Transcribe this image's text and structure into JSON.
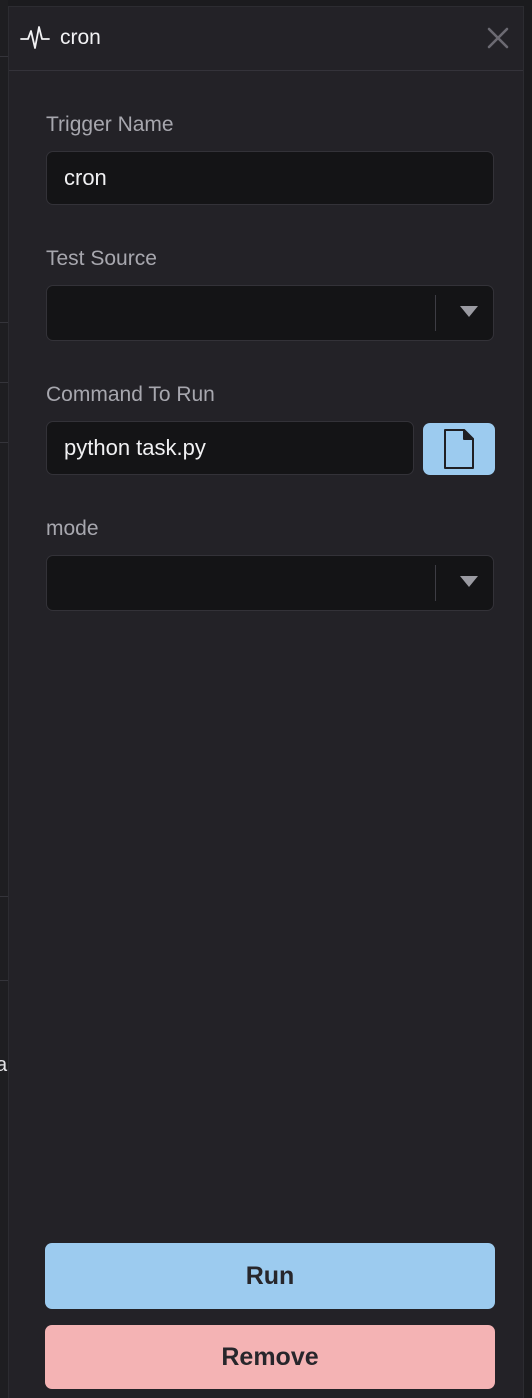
{
  "header": {
    "title": "cron",
    "icon": "activity-pulse-icon",
    "close_icon": "close-icon"
  },
  "form": {
    "trigger_name": {
      "label": "Trigger Name",
      "value": "cron"
    },
    "test_source": {
      "label": "Test Source",
      "value": ""
    },
    "command": {
      "label": "Command To Run",
      "value": "python task.py",
      "file_icon": "file-icon"
    },
    "mode": {
      "label": "mode",
      "value": ""
    }
  },
  "actions": {
    "run_label": "Run",
    "remove_label": "Remove"
  },
  "background": {
    "partial_text": "a"
  },
  "colors": {
    "panel_bg": "#232227",
    "input_bg": "#141416",
    "run_button": "#9ccbef",
    "remove_button": "#f4b3b4",
    "label_text": "#a7a7ae"
  }
}
